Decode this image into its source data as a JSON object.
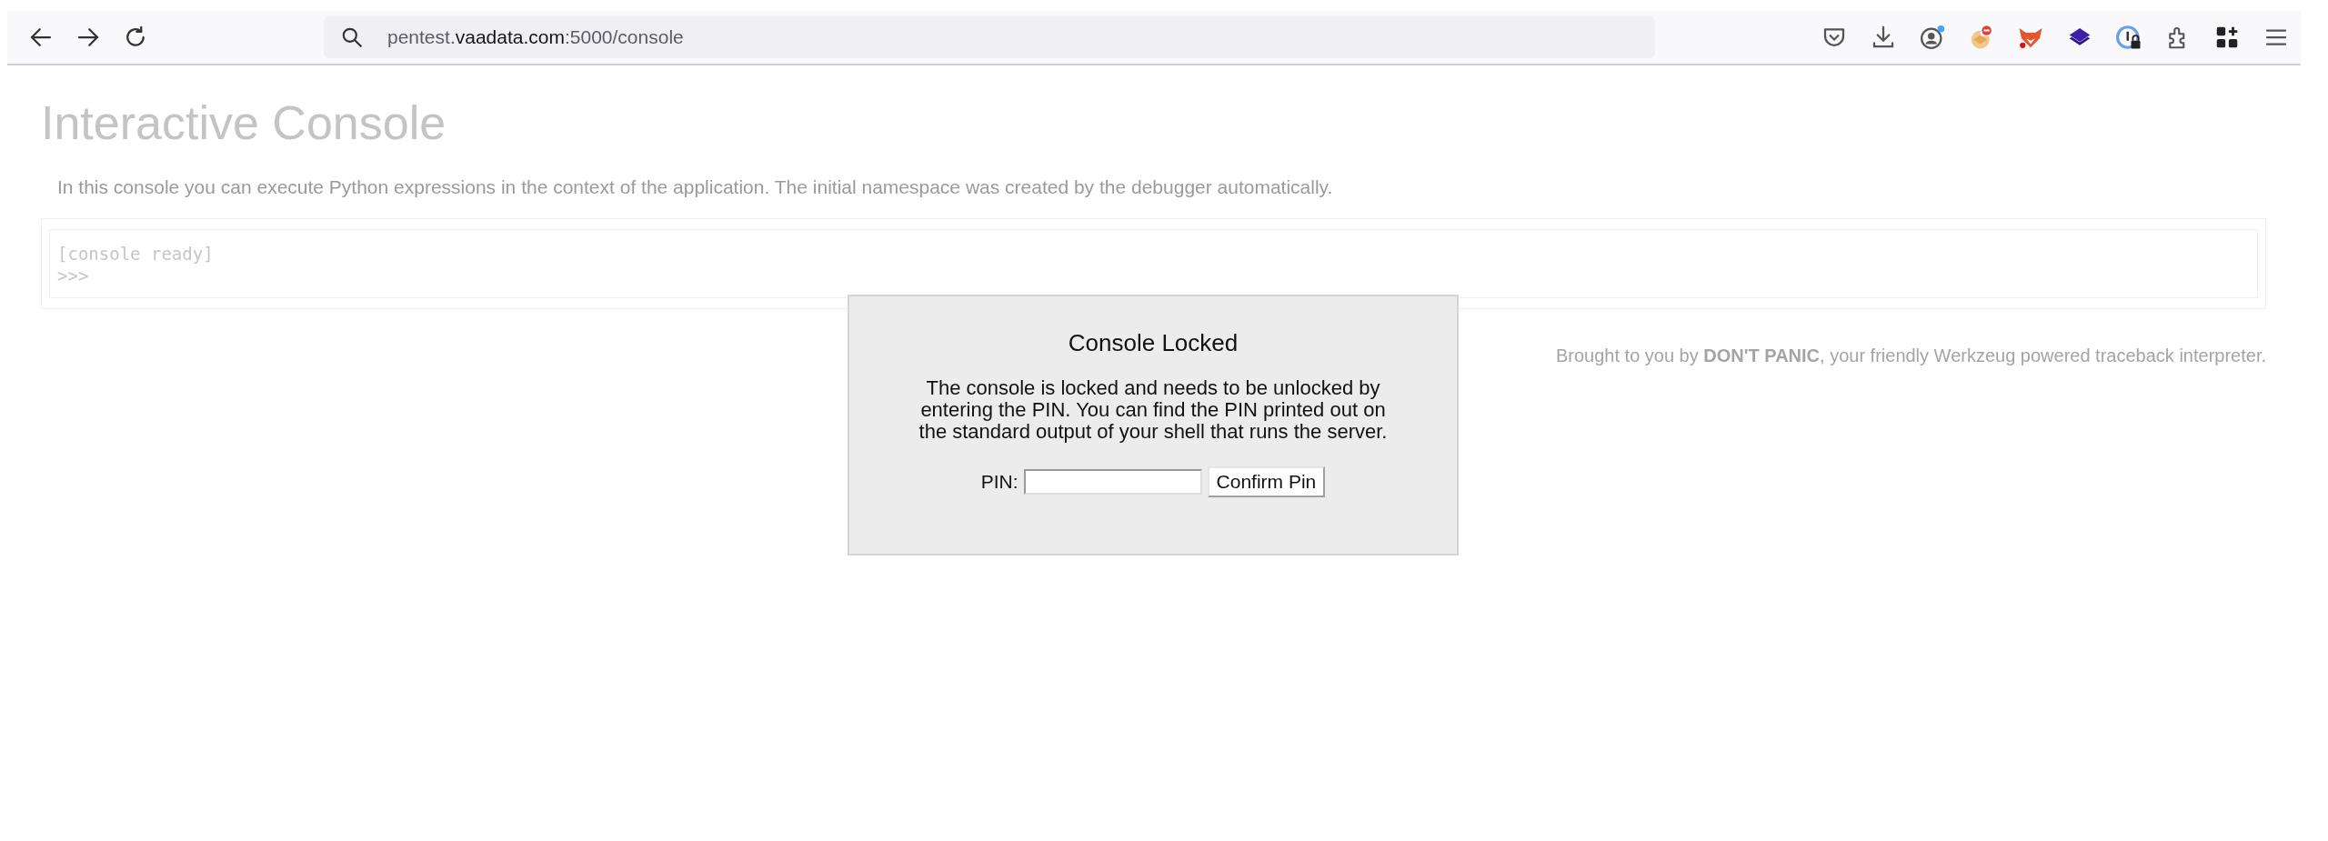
{
  "browser": {
    "url": {
      "subdomain": "pentest.",
      "domain": "vaadata.com",
      "rest": ":5000/console"
    }
  },
  "page": {
    "title": "Interactive Console",
    "intro": "In this console you can execute Python expressions in the context of the application. The initial namespace was created by the debugger automatically.",
    "console_lines": [
      "[console ready]",
      ">>>"
    ],
    "footer": "Brought to you by **DON'T PANIC**, your friendly Werkzeug powered traceback interpreter."
  },
  "dialog": {
    "title": "Console Locked",
    "message": "The console is locked and needs to be unlocked by entering the PIN. You can find the PIN printed out on the standard output of your shell that runs the server.",
    "pin_label": "PIN:",
    "button": "Confirm Pin"
  }
}
